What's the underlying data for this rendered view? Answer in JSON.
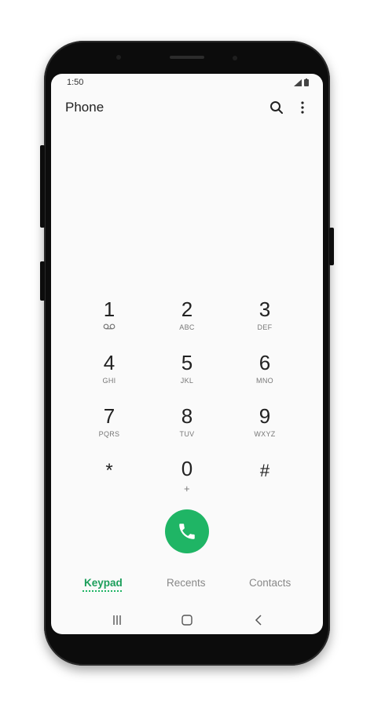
{
  "status_bar": {
    "time": "1:50"
  },
  "app": {
    "title": "Phone"
  },
  "toolbar": {
    "search_icon": "search-icon",
    "menu_icon": "more-vert-icon"
  },
  "keypad": {
    "keys": [
      {
        "digit": "1",
        "letters": "",
        "icon": "voicemail-icon"
      },
      {
        "digit": "2",
        "letters": "ABC"
      },
      {
        "digit": "3",
        "letters": "DEF"
      },
      {
        "digit": "4",
        "letters": "GHI"
      },
      {
        "digit": "5",
        "letters": "JKL"
      },
      {
        "digit": "6",
        "letters": "MNO"
      },
      {
        "digit": "7",
        "letters": "PQRS"
      },
      {
        "digit": "8",
        "letters": "TUV"
      },
      {
        "digit": "9",
        "letters": "WXYZ"
      },
      {
        "digit": "*",
        "letters": ""
      },
      {
        "digit": "0",
        "letters": "+"
      },
      {
        "digit": "#",
        "letters": ""
      }
    ]
  },
  "call_button": {
    "icon": "phone-icon",
    "color": "#1fb565"
  },
  "tabs": [
    {
      "label": "Keypad",
      "active": true
    },
    {
      "label": "Recents",
      "active": false
    },
    {
      "label": "Contacts",
      "active": false
    }
  ],
  "nav_bar": {
    "icons": [
      "recent-apps-icon",
      "home-icon",
      "back-icon"
    ]
  },
  "colors": {
    "accent": "#1fb565",
    "accent_text": "#1b9e5a"
  }
}
